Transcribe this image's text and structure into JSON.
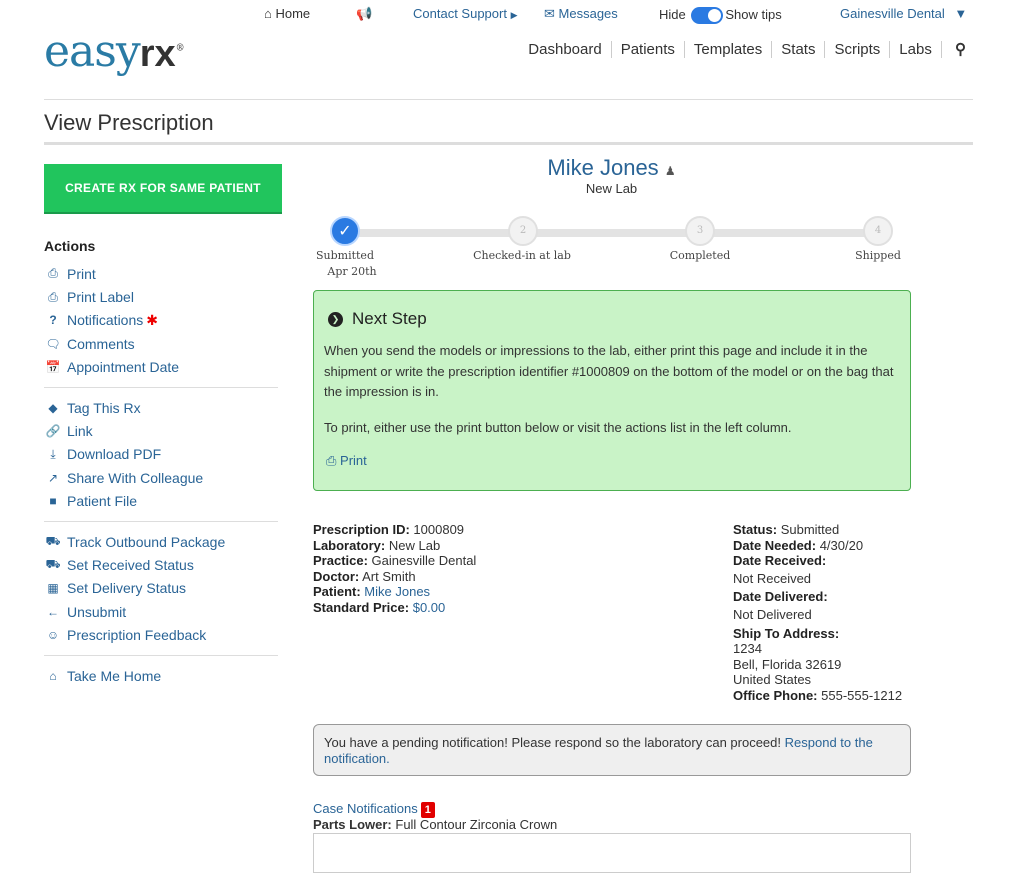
{
  "topnav": {
    "home": "Home",
    "contact_support": "Contact Support",
    "messages": "Messages",
    "hide": "Hide",
    "show_tips": "Show tips",
    "practice": "Gainesville Dental"
  },
  "logo": {
    "main": "easy",
    "bold": "rx",
    "mark": "®"
  },
  "mainnav": [
    "Dashboard",
    "Patients",
    "Templates",
    "Stats",
    "Scripts",
    "Labs"
  ],
  "page_title": "View Prescription",
  "create_button": "CREATE RX FOR SAME PATIENT",
  "actions_title": "Actions",
  "sidebar": {
    "group1": [
      {
        "label": "Print",
        "icon": "printer-icon"
      },
      {
        "label": "Print Label",
        "icon": "printer-icon"
      },
      {
        "label": "Notifications",
        "icon": "question-icon"
      },
      {
        "label": "Comments",
        "icon": "comments-icon"
      },
      {
        "label": "Appointment Date",
        "icon": "calendar-icon"
      }
    ],
    "group2": [
      {
        "label": "Tag This Rx",
        "icon": "tag-icon"
      },
      {
        "label": "Link",
        "icon": "link-icon"
      },
      {
        "label": "Download PDF",
        "icon": "download-icon"
      },
      {
        "label": "Share With Colleague",
        "icon": "share-icon"
      },
      {
        "label": "Patient File",
        "icon": "folder-icon"
      }
    ],
    "group3": [
      {
        "label": "Track Outbound Package",
        "icon": "truck-icon"
      },
      {
        "label": "Set Received Status",
        "icon": "truck-icon"
      },
      {
        "label": "Set Delivery Status",
        "icon": "gift-icon"
      },
      {
        "label": "Unsubmit",
        "icon": "arrow-left-icon"
      },
      {
        "label": "Prescription Feedback",
        "icon": "smile-icon"
      }
    ],
    "group4": [
      {
        "label": "Take Me Home",
        "icon": "home-icon"
      }
    ]
  },
  "patient": {
    "name": "Mike Jones",
    "lab": "New Lab"
  },
  "progress": {
    "steps": [
      {
        "label": "Submitted",
        "date": "Apr 20th",
        "number": "",
        "done": true
      },
      {
        "label": "Checked-in at lab",
        "date": "",
        "number": "2",
        "done": false
      },
      {
        "label": "Completed",
        "date": "",
        "number": "3",
        "done": false
      },
      {
        "label": "Shipped",
        "date": "",
        "number": "4",
        "done": false
      }
    ]
  },
  "next_step": {
    "title": "Next Step",
    "para1": "When you send the models or impressions to the lab, either print this page and include it in the shipment or write the prescription identifier #1000809 on the bottom of the model or on the bag that the impression is in.",
    "para2": "To print, either use the print button below or visit the actions list in the left column.",
    "print_label": "Print"
  },
  "details_left": {
    "rx_id_label": "Prescription ID:",
    "rx_id": "1000809",
    "lab_label": "Laboratory:",
    "lab": "New Lab",
    "practice_label": "Practice:",
    "practice": "Gainesville Dental",
    "doctor_label": "Doctor:",
    "doctor": "Art Smith",
    "patient_label": "Patient:",
    "patient": "Mike Jones",
    "price_label": "Standard Price:",
    "price": "$0.00"
  },
  "details_right": {
    "status_label": "Status:",
    "status": "Submitted",
    "needed_label": "Date Needed:",
    "needed": "4/30/20",
    "received_label": "Date Received:",
    "received": "Not Received",
    "delivered_label": "Date Delivered:",
    "delivered": "Not Delivered",
    "ship_label": "Ship To Address:",
    "addr1": "1234",
    "addr2": "Bell, Florida 32619",
    "addr3": "United States",
    "phone_label": "Office Phone:",
    "phone": "555-555-1212"
  },
  "pending": {
    "text": "You have a pending notification! Please respond so the laboratory can proceed!",
    "link": "Respond to the notification."
  },
  "case_notifications": {
    "label": "Case Notifications",
    "count": "1"
  },
  "parts": {
    "label": "Parts Lower:",
    "value": "Full Contour Zirconia Crown"
  },
  "colors": {
    "accent": "#2a6496",
    "create_button": "#21c55d",
    "next_box": "#c9f3c7",
    "badge": "#e10000"
  }
}
